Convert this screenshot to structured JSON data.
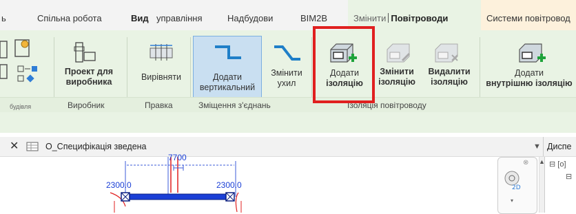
{
  "tabs": {
    "t0": "ь",
    "t1": "Спільна робота",
    "t2": "Вид",
    "t3": "управління",
    "t4": "Надбудови",
    "t5": "BIM2B",
    "t6": "Змінити",
    "t7": "Повітроводи",
    "t8": "Системи повітровод"
  },
  "ribbon": {
    "left_panel_label": "будівля",
    "fab_part": [
      "Проект для",
      "виробника"
    ],
    "align": "Вирівняти",
    "add_vertical": [
      "Додати",
      "вертикальний"
    ],
    "change_slope": [
      "Змінити",
      "ухил"
    ],
    "add_insulation": [
      "Додати",
      "ізоляцію"
    ],
    "edit_insulation": [
      "Змінити",
      "ізоляцію"
    ],
    "remove_insulation": [
      "Видалити",
      "ізоляцію"
    ],
    "add_inner_insulation": [
      "Додати",
      "внутрішню ізоляцію"
    ]
  },
  "panels": {
    "manufacturer": "Виробник",
    "edit": "Правка",
    "offset": "Зміщення з'єднань",
    "duct_insulation": "Ізоляція повітроводу"
  },
  "view": {
    "title": "О_Специфікація зведена",
    "right_panel": "Диспе"
  },
  "drawing": {
    "dim_top": "7700",
    "dim_left": "2300.0",
    "dim_right": "2300.0"
  },
  "colors": {
    "accent_red": "#e01f1f",
    "ribbon_bg": "#e9f3e4",
    "selection": "#c9dff1",
    "drawing_blue": "#1a3fd6"
  }
}
